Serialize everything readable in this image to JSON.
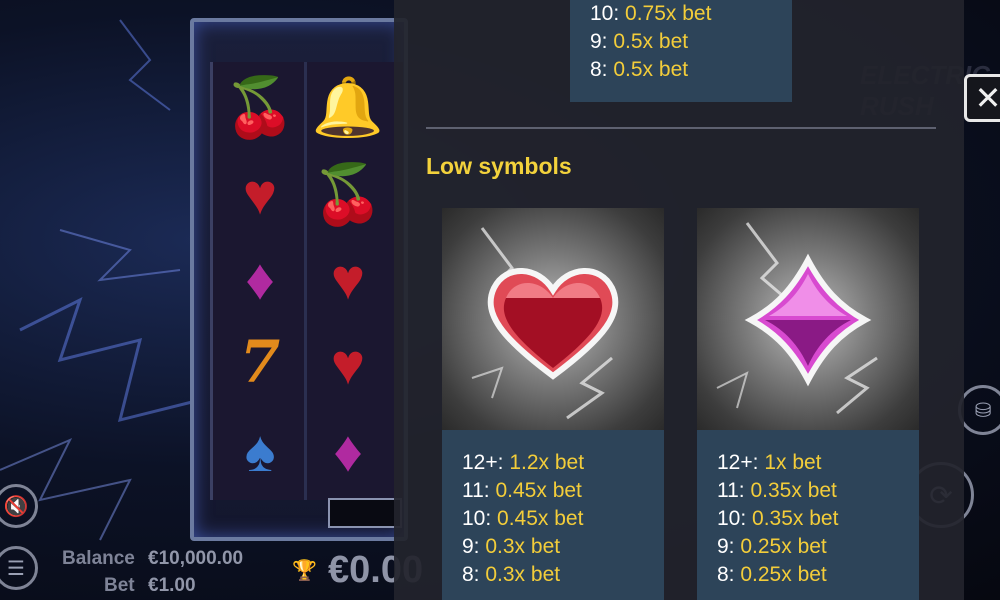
{
  "hud": {
    "balance_label": "Balance",
    "balance_value": "€10,000.00",
    "bet_label": "Bet",
    "bet_value": "€1.00",
    "win_value": "€0.00"
  },
  "paytable": {
    "top_box": {
      "rows": [
        {
          "key": "10:",
          "value": "0.75x bet"
        },
        {
          "key": "9:",
          "value": "0.5x bet"
        },
        {
          "key": "8:",
          "value": "0.5x bet"
        }
      ]
    },
    "low_symbols_title": "Low symbols",
    "cards": [
      {
        "symbol": "heart",
        "rows": [
          {
            "key": "12+:",
            "value": "1.2x bet"
          },
          {
            "key": "11:",
            "value": "0.45x bet"
          },
          {
            "key": "10:",
            "value": "0.45x bet"
          },
          {
            "key": "9:",
            "value": "0.3x bet"
          },
          {
            "key": "8:",
            "value": "0.3x bet"
          }
        ]
      },
      {
        "symbol": "diamond",
        "rows": [
          {
            "key": "12+:",
            "value": "1x bet"
          },
          {
            "key": "11:",
            "value": "0.35x bet"
          },
          {
            "key": "10:",
            "value": "0.35x bet"
          },
          {
            "key": "9:",
            "value": "0.25x bet"
          },
          {
            "key": "8:",
            "value": "0.25x bet"
          }
        ]
      }
    ]
  },
  "icons": {
    "close": "close-icon",
    "sound": "sound-muted-icon",
    "menu": "menu-icon",
    "trophy": "trophy-icon"
  },
  "colors": {
    "accent_yellow": "#f3cd3a",
    "panel_box": "#2d4459",
    "heart": "#d8253a",
    "diamond": "#c62fc0"
  },
  "background_logo": "ELECTRIC RUSH"
}
